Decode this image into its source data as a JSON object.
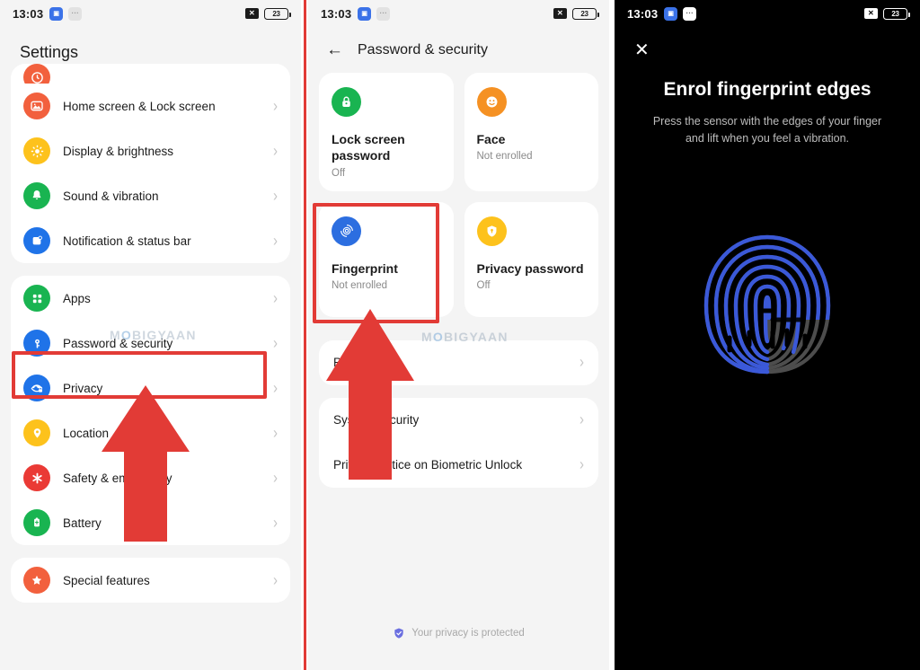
{
  "status_bar": {
    "time": "13:03",
    "battery_level": "23",
    "icons": [
      "app-badge-icon",
      "muted-badge-icon",
      "x-square-icon",
      "battery-icon"
    ]
  },
  "panel1": {
    "name": "settings-screen",
    "title": "Settings",
    "groups": [
      {
        "items": [
          {
            "label": "Home screen & Lock screen",
            "icon": "photo-icon",
            "color": "#f2603d"
          },
          {
            "label": "Display & brightness",
            "icon": "sun-icon",
            "color": "#fdc21c"
          },
          {
            "label": "Sound & vibration",
            "icon": "bell-icon",
            "color": "#19b451"
          },
          {
            "label": "Notification & status bar",
            "icon": "notification-icon",
            "color": "#1f73e8"
          }
        ]
      },
      {
        "items": [
          {
            "label": "Apps",
            "icon": "grid-icon",
            "color": "#19b451"
          },
          {
            "label": "Password & security",
            "icon": "key-icon",
            "color": "#1f73e8",
            "highlighted": true
          },
          {
            "label": "Privacy",
            "icon": "eye-lock-icon",
            "color": "#1f73e8"
          },
          {
            "label": "Location",
            "icon": "location-icon",
            "color": "#fdc21c"
          },
          {
            "label": "Safety & emergency",
            "icon": "asterisk-icon",
            "color": "#ea3a35"
          },
          {
            "label": "Battery",
            "icon": "battery-icon",
            "color": "#19b451"
          }
        ]
      },
      {
        "items": [
          {
            "label": "Special features",
            "icon": "star-icon",
            "color": "#f2603d"
          }
        ]
      }
    ]
  },
  "panel2": {
    "name": "password-and-security-screen",
    "title": "Password & security",
    "back_label": "back-arrow",
    "cards": [
      {
        "title": "Lock screen password",
        "subtitle": "Off",
        "icon": "lock-icon",
        "color": "#19b451"
      },
      {
        "title": "Face",
        "subtitle": "Not enrolled",
        "icon": "face-icon",
        "color": "#f59123"
      },
      {
        "title": "Fingerprint",
        "subtitle": "Not enrolled",
        "icon": "fingerprint-icon",
        "color": "#2c6ee0",
        "highlighted": true
      },
      {
        "title": "Privacy password",
        "subtitle": "Off",
        "icon": "shield-key-icon",
        "color": "#fdc21c"
      }
    ],
    "list_group_1": [
      {
        "label": "Passwords"
      }
    ],
    "list_group_2": [
      {
        "label": "System security"
      },
      {
        "label": "Privacy Notice on Biometric Unlock"
      }
    ],
    "footer": {
      "text": "Your privacy is protected",
      "icon": "shield-check-icon"
    }
  },
  "panel3": {
    "name": "enrol-fingerprint-edges-screen",
    "close_label": "close-icon",
    "title": "Enrol fingerprint edges",
    "subtitle": "Press the sensor with the edges of your finger and lift when you feel a vibration.",
    "graphic": "fingerprint-graphic",
    "colors": {
      "ridge_active": "#3b59d8",
      "ridge_inactive": "#4a4a4a",
      "background": "#000000"
    }
  },
  "annotations": {
    "highlight_color": "#e23b36",
    "arrow_color": "#e23b36",
    "watermark": {
      "pre": "M",
      "o": "O",
      "post": "BIGYAAN"
    }
  }
}
